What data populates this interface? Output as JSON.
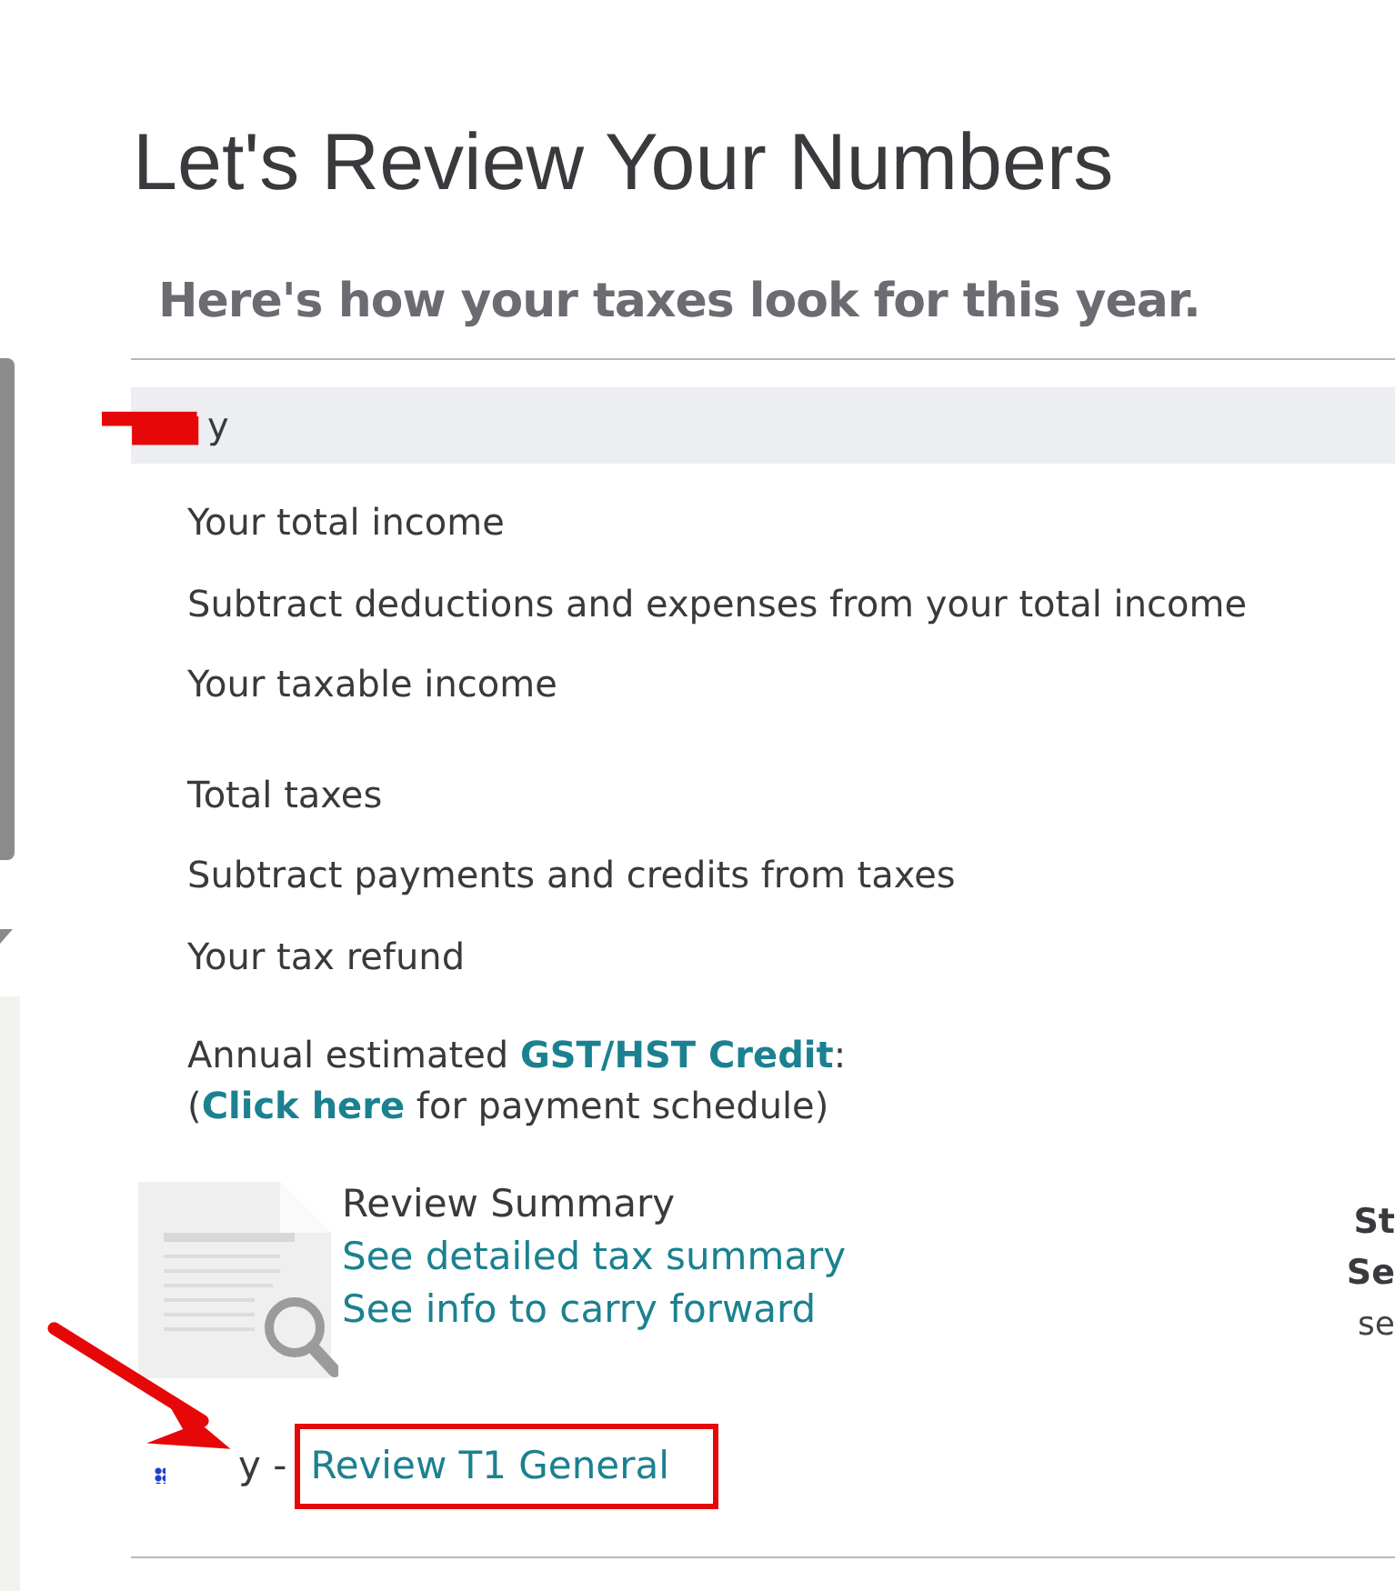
{
  "title": "Let's Review Your Numbers",
  "subtitle": "Here's how your taxes look for this year.",
  "person": {
    "name": "y",
    "redacted": true
  },
  "groups": [
    {
      "items": [
        "Your total income",
        "Subtract deductions and expenses from your total income",
        "Your taxable income"
      ]
    },
    {
      "items": [
        "Total taxes",
        "Subtract payments and credits from taxes",
        "Your tax refund"
      ]
    }
  ],
  "credit_lines": [
    [
      {
        "kind": "text",
        "text": "Annual estimated "
      },
      {
        "kind": "link",
        "text": "GST/HST Credit"
      },
      {
        "kind": "text",
        "text": ":"
      }
    ],
    [
      {
        "kind": "text",
        "text": "("
      },
      {
        "kind": "link",
        "text": "Click here"
      },
      {
        "kind": "text",
        "text": " for payment schedule)"
      }
    ]
  ],
  "review": {
    "heading": "Review Summary",
    "links": [
      "See detailed tax summary",
      "See info to carry forward"
    ]
  },
  "side_column": [
    {
      "text": "St",
      "kind": "heading"
    },
    {
      "text": "Se",
      "kind": "heading"
    },
    {
      "text": "se",
      "kind": "body"
    }
  ],
  "t1": {
    "prefix": "y -",
    "link": "Review T1 General",
    "highlighted": true
  }
}
